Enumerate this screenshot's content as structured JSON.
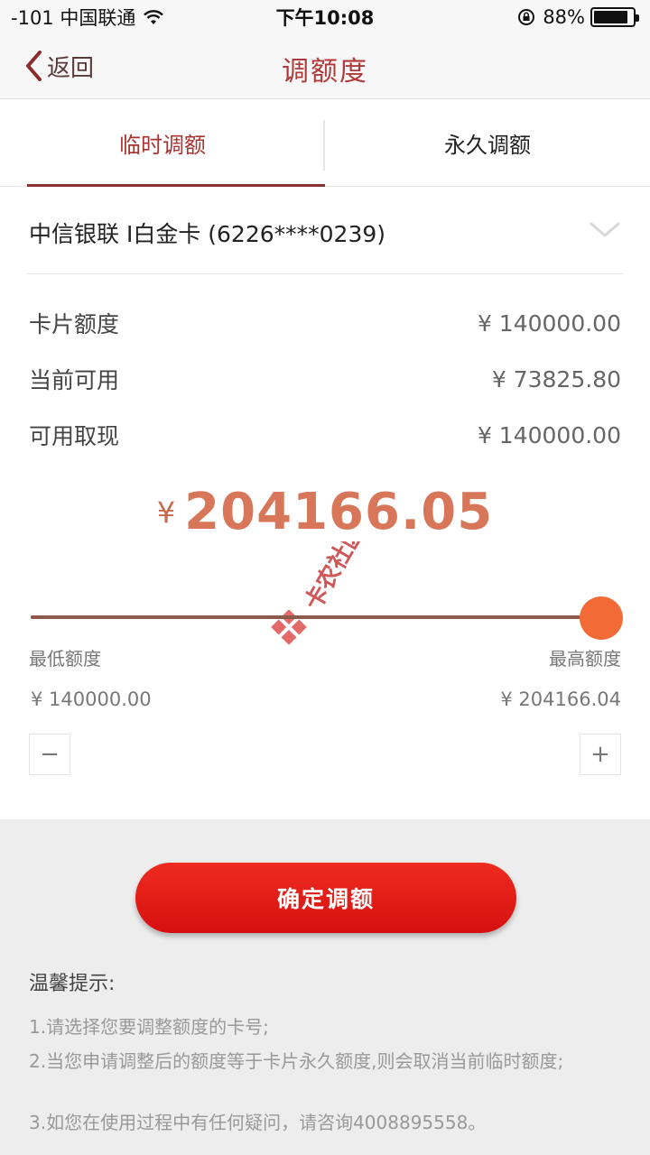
{
  "status_bar": {
    "carrier": "-101 中国联通",
    "time": "下午10:08",
    "battery": "88%",
    "battery_level": 0.88
  },
  "nav": {
    "back_label": "返回",
    "title": "调额度"
  },
  "tabs": [
    {
      "label": "临时调额",
      "active": true
    },
    {
      "label": "永久调额",
      "active": false
    }
  ],
  "card": {
    "label": "中信银联 I白金卡 (6226****0239)"
  },
  "info": {
    "card_limit_label": "卡片额度",
    "card_limit_value": "¥ 140000.00",
    "available_label": "当前可用",
    "available_value": "¥ 73825.80",
    "cash_label": "可用取现",
    "cash_value": "¥ 140000.00"
  },
  "amount": {
    "currency": "¥",
    "value": "204166.05"
  },
  "slider": {
    "level": 1.0,
    "min_label": "最低额度",
    "max_label": "最高额度",
    "min_value": "¥ 140000.00",
    "max_value": "¥ 204166.04",
    "minus": "−",
    "plus": "+"
  },
  "confirm_button": "确定调额",
  "tips": {
    "title": "温馨提示:",
    "items": [
      "1.请选择您要调整额度的卡号;",
      "2.当您申请调整后的额度等于卡片永久额度,则会取消当前临时额度;",
      "3.如您在使用过程中有任何疑问，请咨询4008895558。"
    ]
  },
  "watermark": {
    "text": "卡农社区"
  },
  "colors": {
    "accent": "#a8332f",
    "button": "#e21a14",
    "thumb": "#f26a35",
    "amount": "#d8765a"
  }
}
